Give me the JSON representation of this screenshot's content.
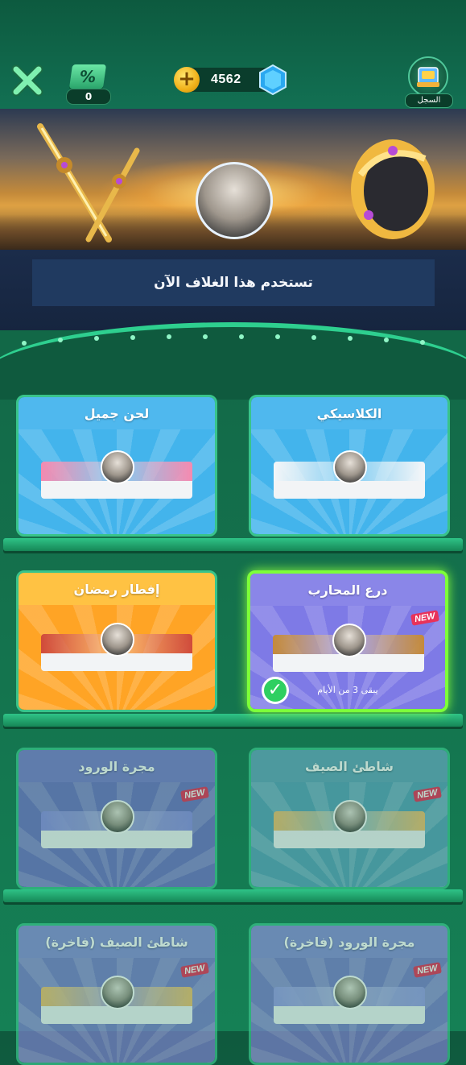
{
  "topbar": {
    "coupon_count": "0",
    "coupon_symbol": "%",
    "coins": "4562",
    "history_label": "السجل"
  },
  "banner": {
    "status_text": "تستخدم هذا الغلاف الآن"
  },
  "cards": [
    {
      "title": "الكلاسيكي",
      "theme": "blue",
      "head_color": "#4fb8ee",
      "body_color": "#43b4ec",
      "deco": "#f4f6f8",
      "new": false
    },
    {
      "title": "لحن جميل",
      "theme": "blue",
      "head_color": "#4fb8ee",
      "body_color": "#43b4ec",
      "deco": "#f48ab0",
      "new": false
    },
    {
      "title": "درع المحارب",
      "theme": "purple",
      "head_color": "#8a86e8",
      "body_color": "#7e7ae6",
      "deco": "#c48a3a",
      "new": true,
      "new_label": "NEW",
      "selected": true,
      "days_text": "يبقى 3 من الأيام"
    },
    {
      "title": "إفطار رمضان",
      "theme": "orange",
      "head_color": "#ffc243",
      "body_color": "#ffa425",
      "deco": "#d04a3a",
      "new": false
    },
    {
      "title": "شاطئ الصيف",
      "theme": "teal",
      "head_color": "#63a7bd",
      "body_color": "#5aa3bb",
      "deco": "#f0c070",
      "new": true,
      "new_label": "NEW"
    },
    {
      "title": "مجرة الورود",
      "theme": "violet",
      "head_color": "#7d7fd0",
      "body_color": "#7074c6",
      "deco": "#8e8fe6",
      "new": true,
      "new_label": "NEW"
    },
    {
      "title": "مجرة الورود (فاخرة)",
      "theme": "violet",
      "head_color": "#8a90d8",
      "body_color": "#7c80cc",
      "deco": "#9a9de8",
      "new": true,
      "new_label": "NEW"
    },
    {
      "title": "شاطئ الصيف (فاخرة)",
      "theme": "violet",
      "head_color": "#8a90d8",
      "body_color": "#7c80cc",
      "deco": "#f0c070",
      "new": true,
      "new_label": "NEW"
    }
  ]
}
